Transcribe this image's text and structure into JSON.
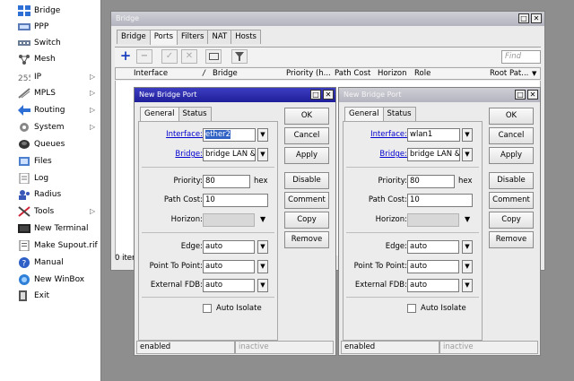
{
  "sidebar": {
    "items": [
      {
        "label": "Bridge",
        "icon": "bridge-icon",
        "arrow": ""
      },
      {
        "label": "PPP",
        "icon": "ppp-icon",
        "arrow": ""
      },
      {
        "label": "Switch",
        "icon": "switch-icon",
        "arrow": ""
      },
      {
        "label": "Mesh",
        "icon": "mesh-icon",
        "arrow": ""
      },
      {
        "label": "IP",
        "icon": "ip-icon",
        "arrow": "▷"
      },
      {
        "label": "MPLS",
        "icon": "mpls-icon",
        "arrow": "▷"
      },
      {
        "label": "Routing",
        "icon": "routing-icon",
        "arrow": "▷"
      },
      {
        "label": "System",
        "icon": "system-icon",
        "arrow": "▷"
      },
      {
        "label": "Queues",
        "icon": "queues-icon",
        "arrow": ""
      },
      {
        "label": "Files",
        "icon": "files-icon",
        "arrow": ""
      },
      {
        "label": "Log",
        "icon": "log-icon",
        "arrow": ""
      },
      {
        "label": "Radius",
        "icon": "radius-icon",
        "arrow": ""
      },
      {
        "label": "Tools",
        "icon": "tools-icon",
        "arrow": "▷"
      },
      {
        "label": "New Terminal",
        "icon": "terminal-icon",
        "arrow": ""
      },
      {
        "label": "Make Supout.rif",
        "icon": "supout-icon",
        "arrow": ""
      },
      {
        "label": "Manual",
        "icon": "manual-icon",
        "arrow": ""
      },
      {
        "label": "New WinBox",
        "icon": "winbox-icon",
        "arrow": ""
      },
      {
        "label": "Exit",
        "icon": "exit-icon",
        "arrow": ""
      }
    ]
  },
  "bridge_window": {
    "title": "Bridge",
    "tabs": [
      "Bridge",
      "Ports",
      "Filters",
      "NAT",
      "Hosts"
    ],
    "active_tab": "Ports",
    "find_placeholder": "Find",
    "columns": [
      "Interface",
      "/",
      "Bridge",
      "Priority (h...",
      "Path Cost",
      "Horizon",
      "Role",
      "Root Pat..."
    ],
    "status": "0 item"
  },
  "port_left": {
    "title": "New Bridge Port",
    "tabs": [
      "General",
      "Status"
    ],
    "interface_label": "Interface:",
    "interface_value": "ether2",
    "bridge_label": "Bridge:",
    "bridge_value": "bridge LAN &",
    "priority_label": "Priority:",
    "priority_value": "80",
    "priority_unit": "hex",
    "path_cost_label": "Path Cost:",
    "path_cost_value": "10",
    "horizon_label": "Horizon:",
    "edge_label": "Edge:",
    "edge_value": "auto",
    "p2p_label": "Point To Point:",
    "p2p_value": "auto",
    "fdb_label": "External FDB:",
    "fdb_value": "auto",
    "auto_isolate_label": "Auto Isolate",
    "buttons": [
      "OK",
      "Cancel",
      "Apply",
      "Disable",
      "Comment",
      "Copy",
      "Remove"
    ],
    "status_left": "enabled",
    "status_right": "inactive"
  },
  "port_right": {
    "title": "New Bridge Port",
    "tabs": [
      "General",
      "Status"
    ],
    "interface_label": "Interface:",
    "interface_value": "wlan1",
    "bridge_label": "Bridge:",
    "bridge_value": "bridge LAN &",
    "priority_label": "Priority:",
    "priority_value": "80",
    "priority_unit": "hex",
    "path_cost_label": "Path Cost:",
    "path_cost_value": "10",
    "horizon_label": "Horizon:",
    "edge_label": "Edge:",
    "edge_value": "auto",
    "p2p_label": "Point To Point:",
    "p2p_value": "auto",
    "fdb_label": "External FDB:",
    "fdb_value": "auto",
    "auto_isolate_label": "Auto Isolate",
    "buttons": [
      "OK",
      "Cancel",
      "Apply",
      "Disable",
      "Comment",
      "Copy",
      "Remove"
    ],
    "status_left": "enabled",
    "status_right": "inactive"
  }
}
